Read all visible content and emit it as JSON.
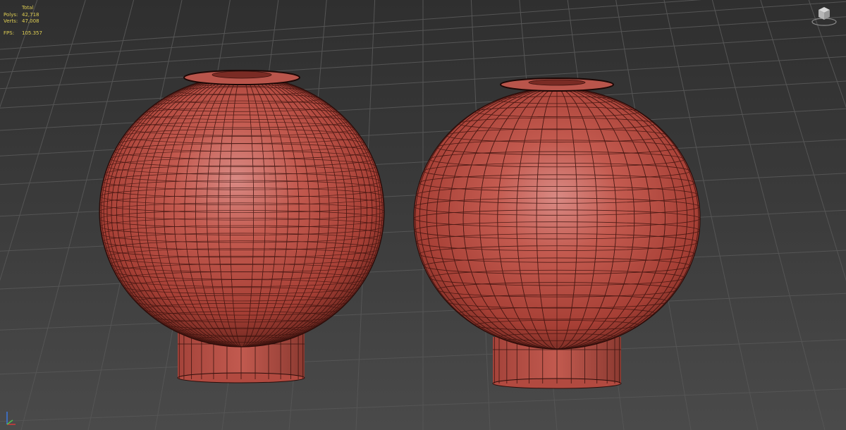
{
  "viewport": {
    "stats": {
      "header": "Total",
      "rows": [
        {
          "label": "Polys:",
          "value": "42,718"
        },
        {
          "label": "Verts:",
          "value": "47,008"
        }
      ],
      "fps_label": "FPS:",
      "fps_value": "105.357",
      "color": "#e0cf52"
    },
    "background_color": "#3a3a3a",
    "grid_color": "#555555",
    "object_color": "#c0473c",
    "icons": {
      "viewcube": "viewcube-icon",
      "axis": "axis-tripod-icon"
    }
  }
}
